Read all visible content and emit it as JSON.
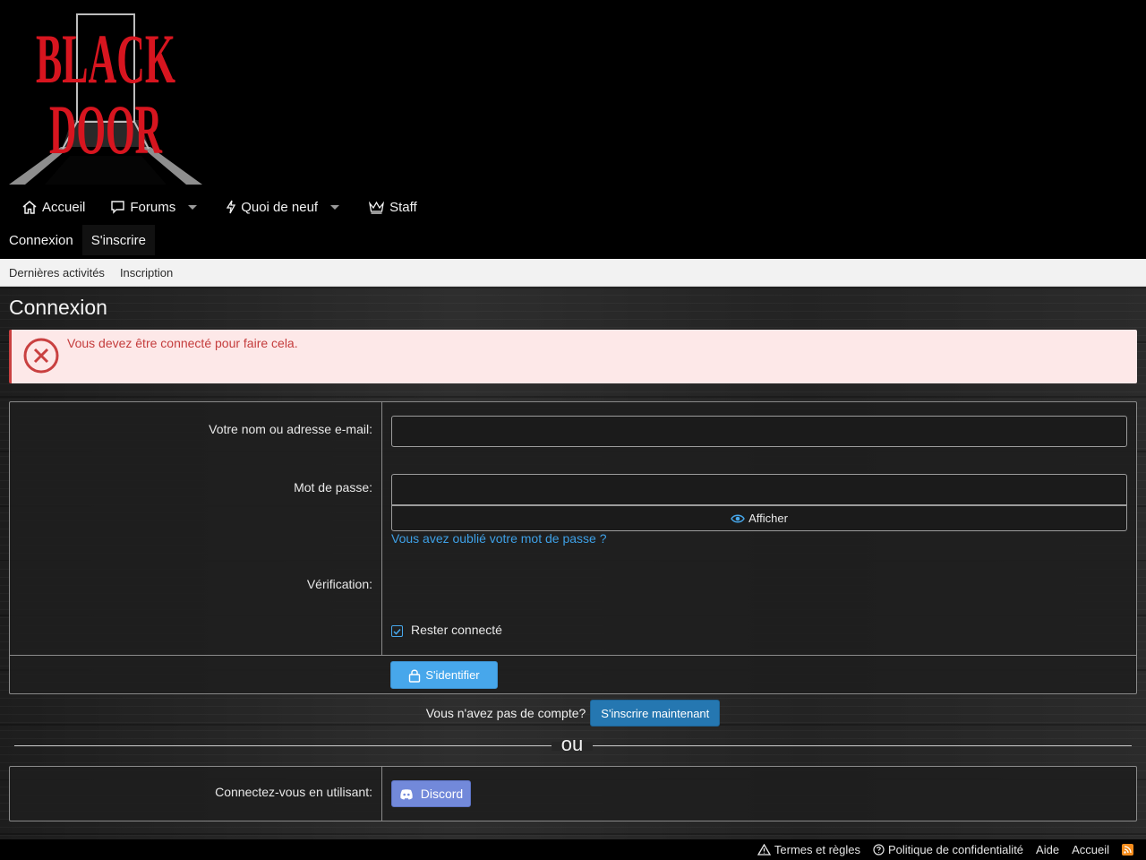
{
  "header": {
    "logo_text": [
      "BLACK",
      "DOOR"
    ],
    "nav": [
      {
        "label": "Accueil",
        "icon": "home-icon"
      },
      {
        "label": "Forums",
        "icon": "comment-icon",
        "has_menu": true
      },
      {
        "label": "Quoi de neuf",
        "icon": "bolt-icon",
        "has_menu": true
      },
      {
        "label": "Staff",
        "icon": "crown-icon"
      }
    ],
    "user_links": [
      {
        "label": "Connexion"
      },
      {
        "label": "S'inscrire"
      }
    ]
  },
  "subnav": {
    "items": [
      "Dernières activités",
      "Inscription"
    ]
  },
  "page": {
    "title": "Connexion",
    "alert": "Vous devez être connecté pour faire cela."
  },
  "login_form": {
    "username_label": "Votre nom ou adresse e-mail:",
    "username_value": "",
    "password_label": "Mot de passe:",
    "password_value": "",
    "show_password_label": "Afficher",
    "forgot_password_link": "Vous avez oublié votre mot de passe ?",
    "verification_label": "Vérification:",
    "remember_label": "Rester connecté",
    "remember_checked": true,
    "submit_label": "S'identifier"
  },
  "register": {
    "prompt": "Vous n'avez pas de compte?",
    "button": "S'inscrire maintenant"
  },
  "divider_text": "ou",
  "connect_with": {
    "label": "Connectez-vous en utilisant:",
    "discord_label": "Discord"
  },
  "footer": {
    "links": [
      {
        "label": "Termes et règles",
        "icon": "warning-icon"
      },
      {
        "label": "Politique de confidentialité",
        "icon": "help-icon"
      },
      {
        "label": "Aide"
      },
      {
        "label": "Accueil"
      }
    ],
    "rss_icon": "rss-icon"
  },
  "colors": {
    "accent": "#47a7eb",
    "register_button": "#2577b1",
    "discord": "#7289da",
    "error": "#c43c3c",
    "logo_red": "#d7151f"
  }
}
